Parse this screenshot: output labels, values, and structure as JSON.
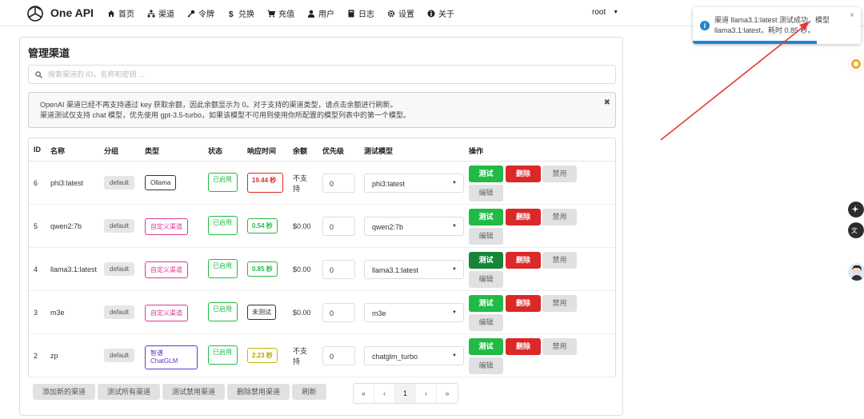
{
  "app": {
    "name": "One API"
  },
  "nav": {
    "items": [
      {
        "label": "首页",
        "icon": "home-icon"
      },
      {
        "label": "渠道",
        "icon": "sitemap-icon"
      },
      {
        "label": "令牌",
        "icon": "key-icon"
      },
      {
        "label": "兑换",
        "icon": "dollar-icon"
      },
      {
        "label": "充值",
        "icon": "cart-icon"
      },
      {
        "label": "用户",
        "icon": "user-icon"
      },
      {
        "label": "日志",
        "icon": "book-icon"
      },
      {
        "label": "设置",
        "icon": "gear-icon"
      },
      {
        "label": "关于",
        "icon": "info-icon"
      }
    ],
    "user": "root"
  },
  "page": {
    "title": "管理渠道",
    "search_placeholder": "搜索渠道的 ID，名称和密钥 ...",
    "notice_line1": "OpenAI 渠道已经不再支持通过 key 获取余额，因此余额显示为 0。对于支持的渠道类型，请点击余额进行刷新。",
    "notice_line2": "渠道测试仅支持 chat 模型，优先使用 gpt-3.5-turbo，如果该模型不可用则使用你所配置的模型列表中的第一个模型。",
    "notice_close": "✖"
  },
  "table": {
    "headers": {
      "id": "ID",
      "name": "名称",
      "group": "分组",
      "type": "类型",
      "status": "状态",
      "response": "响应时间",
      "balance": "余额",
      "priority": "优先级",
      "test_model": "测试模型",
      "actions": "操作"
    },
    "rows": [
      {
        "id": "6",
        "name": "phi3:latest",
        "group": "default",
        "type": "Ollama",
        "status": "已启用",
        "response": "19.44 秒",
        "balance": "不支持",
        "priority": "0",
        "model": "phi3:latest"
      },
      {
        "id": "5",
        "name": "qwen2:7b",
        "group": "default",
        "type": "自定义渠道",
        "status": "已启用",
        "response": "0.54 秒",
        "balance": "$0.00",
        "priority": "0",
        "model": "qwen2:7b"
      },
      {
        "id": "4",
        "name": "llama3.1:latest",
        "group": "default",
        "type": "自定义渠道",
        "status": "已启用",
        "response": "0.85 秒",
        "balance": "$0.00",
        "priority": "0",
        "model": "llama3.1:latest"
      },
      {
        "id": "3",
        "name": "m3e",
        "group": "default",
        "type": "自定义渠道",
        "status": "已启用",
        "response": "未测试",
        "balance": "$0.00",
        "priority": "0",
        "model": "m3e"
      },
      {
        "id": "2",
        "name": "zp",
        "group": "default",
        "type": "智谱 ChatGLM",
        "status": "已启用",
        "response": "2.23 秒",
        "balance": "不支持",
        "priority": "0",
        "model": "chatglm_turbo"
      }
    ],
    "actions": {
      "test": "测试",
      "delete": "删除",
      "disable": "禁用",
      "edit": "编辑"
    }
  },
  "footer": {
    "add": "添加新的渠道",
    "test_all": "测试所有渠道",
    "test_disabled": "测试禁用渠道",
    "delete_disabled": "删除禁用渠道",
    "refresh": "刷新",
    "pager": {
      "first": "«",
      "prev": "‹",
      "current": "1",
      "next": "›",
      "last": "»"
    }
  },
  "toast": {
    "message": "渠道 llama3.1:latest 测试成功，模型 llama3.1:latest，耗时 0.85 秒。",
    "close": "×"
  },
  "colors": {
    "green": "#21ba45",
    "red": "#db2828",
    "blue": "#2185d0",
    "pink": "#e03997",
    "purple": "#6435c9",
    "annotation_arrow": "#e53935"
  }
}
